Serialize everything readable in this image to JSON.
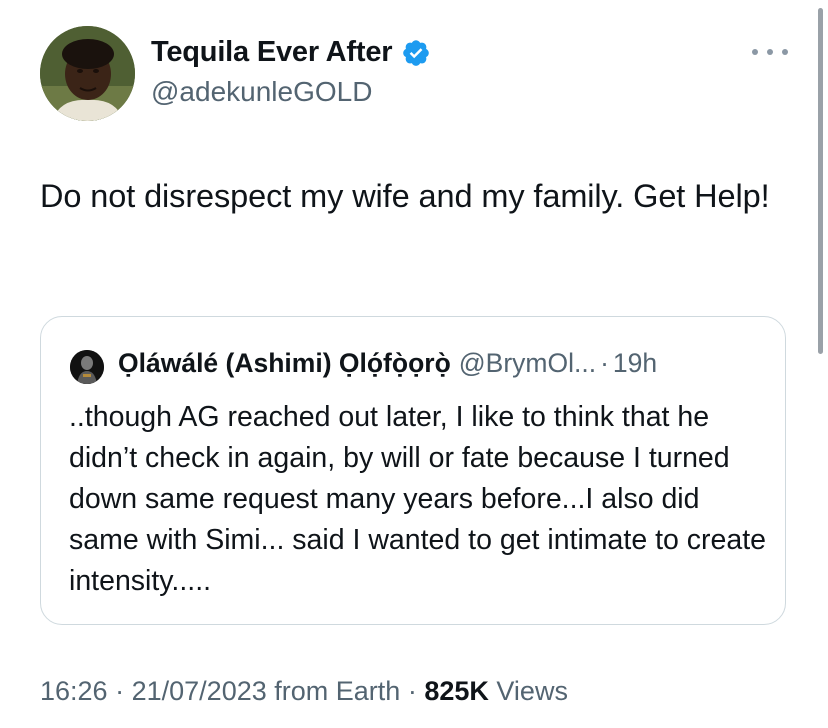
{
  "author": {
    "display_name": "Tequila Ever After",
    "handle": "@adekunleGOLD",
    "verified": true
  },
  "tweet": {
    "text": "Do not disrespect my wife and my family. Get Help!"
  },
  "quoted_tweet": {
    "display_name": "Ọláwálé (Ashimi) Ọlọ́fọ̀ọrọ̀",
    "handle": "@BrymOl...",
    "separator": "·",
    "time": "19h",
    "text": "..though AG reached out later, I like to think that he didn’t check in again, by will or fate because I turned down same request many years before...I also did same with Simi... said I wanted to get intimate to create intensity....."
  },
  "meta": {
    "time": "16:26",
    "separator": "·",
    "date": "21/07/2023",
    "source": "from Earth",
    "views_count": "825K",
    "views_label": "Views"
  },
  "colors": {
    "text_primary": "#0f1419",
    "text_secondary": "#536471",
    "verified_blue": "#1d9bf0",
    "border": "#cfd9de"
  },
  "icons": {
    "verified": "verified-badge-icon",
    "more": "more-horizontal-icon"
  }
}
